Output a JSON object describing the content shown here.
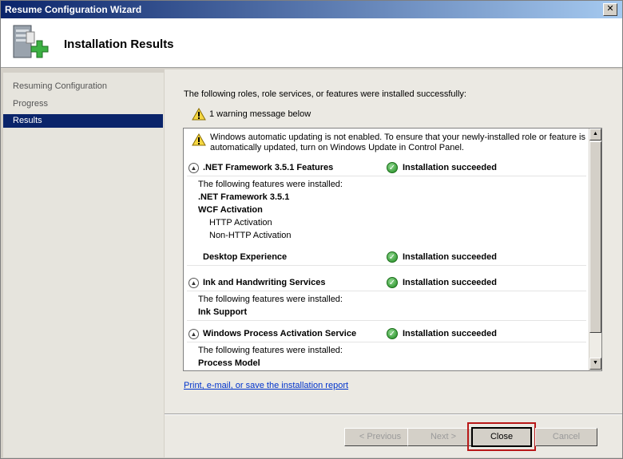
{
  "window": {
    "title": "Resume Configuration Wizard",
    "close_glyph": "✕"
  },
  "header": {
    "title": "Installation Results",
    "icon": "server-install-icon"
  },
  "sidebar": {
    "items": [
      {
        "label": "Resuming Configuration",
        "selected": false
      },
      {
        "label": "Progress",
        "selected": false
      },
      {
        "label": "Results",
        "selected": true
      }
    ]
  },
  "content": {
    "intro": "The following roles, role services, or features were installed successfully:",
    "warning_summary": "1 warning message below",
    "warning_line1": "Windows automatic updating is not enabled. To ensure that your newly-installed role or feature is",
    "warning_line2": "automatically updated, turn on Windows Update in Control Panel.",
    "features_installed_text": "The following features were installed:",
    "sections": [
      {
        "name": ".NET Framework 3.5.1 Features",
        "status": "Installation succeeded",
        "items": [
          ".NET Framework 3.5.1",
          "WCF Activation",
          "HTTP Activation",
          "Non-HTTP Activation"
        ],
        "sub_feature": {
          "name": "Desktop Experience",
          "status": "Installation succeeded"
        }
      },
      {
        "name": "Ink and Handwriting Services",
        "status": "Installation succeeded",
        "items": [
          "Ink Support"
        ]
      },
      {
        "name": "Windows Process Activation Service",
        "status": "Installation succeeded",
        "items": [
          "Process Model"
        ]
      }
    ],
    "report_link": "Print, e-mail, or save the installation report"
  },
  "buttons": {
    "previous": "< Previous",
    "next": "Next >",
    "close": "Close",
    "cancel": "Cancel"
  },
  "colors": {
    "title_bar": "#0a246a",
    "selected_item": "#0a246a",
    "success": "#1e8a1e",
    "link": "#0033cc",
    "highlight": "#b81818"
  }
}
